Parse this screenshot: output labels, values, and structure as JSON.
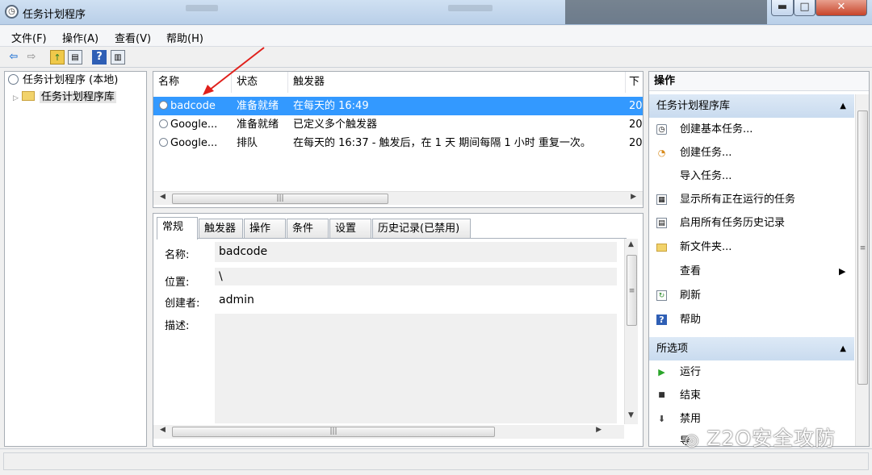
{
  "window": {
    "title": "任务计划程序",
    "buttons": {
      "minimize": "▬",
      "maximize": "□",
      "close": "✕"
    }
  },
  "menu": [
    "文件(F)",
    "操作(A)",
    "查看(V)",
    "帮助(H)"
  ],
  "toolbar": {
    "icons": [
      "back-arrow-icon",
      "forward-arrow-icon",
      "up-folder-icon",
      "show-hide-tree-icon",
      "help-icon",
      "show-hide-action-pane-icon"
    ]
  },
  "tree": {
    "root_label": "任务计划程序 (本地)",
    "child_label": "任务计划程序库"
  },
  "task_list": {
    "columns": [
      "名称",
      "状态",
      "触发器",
      "下"
    ],
    "rows": [
      {
        "name": "badcode",
        "status": "准备就绪",
        "trigger": "在每天的 16:49",
        "next": "20",
        "selected": true
      },
      {
        "name": "Google...",
        "status": "准备就绪",
        "trigger": "已定义多个触发器",
        "next": "20",
        "selected": false
      },
      {
        "name": "Google...",
        "status": "排队",
        "trigger": "在每天的 16:37 - 触发后，在 1 天 期间每隔 1 小时 重复一次。",
        "next": "20",
        "selected": false
      }
    ]
  },
  "detail": {
    "tabs": [
      "常规",
      "触发器",
      "操作",
      "条件",
      "设置",
      "历史记录(已禁用)"
    ],
    "active_tab": "常规",
    "fields": {
      "name_label": "名称:",
      "name_value": "badcode",
      "location_label": "位置:",
      "location_value": "\\",
      "author_label": "创建者:",
      "author_value": "admin",
      "description_label": "描述:",
      "description_value": ""
    }
  },
  "actions": {
    "title": "操作",
    "library_section": "任务计划程序库",
    "library_items": [
      {
        "icon": "create-basic-task-icon",
        "label": "创建基本任务..."
      },
      {
        "icon": "create-task-icon",
        "label": "创建任务..."
      },
      {
        "icon": "",
        "label": "导入任务..."
      },
      {
        "icon": "running-tasks-icon",
        "label": "显示所有正在运行的任务"
      },
      {
        "icon": "enable-history-icon",
        "label": "启用所有任务历史记录"
      },
      {
        "icon": "new-folder-icon",
        "label": "新文件夹..."
      },
      {
        "icon": "",
        "label": "查看",
        "submenu": true
      },
      {
        "icon": "refresh-icon",
        "label": "刷新"
      },
      {
        "icon": "help-icon",
        "label": "帮助"
      }
    ],
    "selected_section": "所选项",
    "selected_items": [
      {
        "icon": "run-icon",
        "label": "运行"
      },
      {
        "icon": "end-icon",
        "label": "结束"
      },
      {
        "icon": "disable-icon",
        "label": "禁用"
      },
      {
        "icon": "export-icon",
        "label": "导"
      }
    ]
  },
  "watermark": "Z2O安全攻防",
  "colors": {
    "selection": "#3399ff",
    "annotation_arrow": "#e0201b",
    "section_header": "#d3e3f4"
  }
}
